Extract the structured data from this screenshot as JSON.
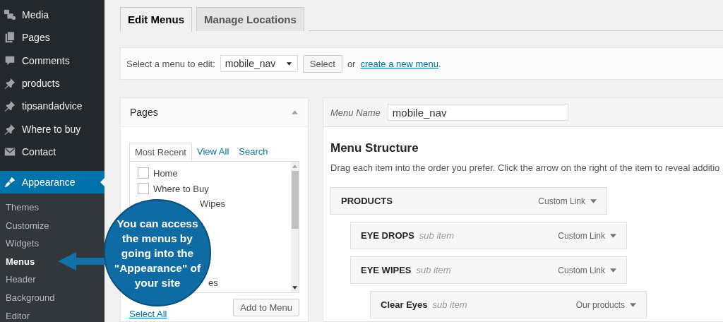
{
  "sidebar": {
    "items": [
      {
        "label": "Media",
        "kind": "media",
        "selected": false
      },
      {
        "label": "Pages",
        "kind": "pages",
        "selected": false
      },
      {
        "label": "Comments",
        "kind": "comments",
        "selected": false
      },
      {
        "label": "products",
        "kind": "pin",
        "selected": false
      },
      {
        "label": "tipsandadvice",
        "kind": "pin",
        "selected": false
      },
      {
        "label": "Where to buy",
        "kind": "pin",
        "selected": false
      },
      {
        "label": "Contact",
        "kind": "mail",
        "selected": false
      },
      {
        "label": "Appearance",
        "kind": "brush",
        "selected": true
      }
    ],
    "submenu": [
      {
        "label": "Themes",
        "selected": false
      },
      {
        "label": "Customize",
        "selected": false
      },
      {
        "label": "Widgets",
        "selected": false
      },
      {
        "label": "Menus",
        "selected": true
      },
      {
        "label": "Header",
        "selected": false
      },
      {
        "label": "Background",
        "selected": false
      },
      {
        "label": "Editor",
        "selected": false
      }
    ]
  },
  "tabs": [
    {
      "label": "Edit Menus",
      "selected": true
    },
    {
      "label": "Manage Locations",
      "selected": false
    }
  ],
  "menu_select": {
    "label": "Select a menu to edit:",
    "value": "mobile_nav",
    "button": "Select",
    "or_text": "or",
    "link": "create a new menu",
    "after": "."
  },
  "pages_panel": {
    "title": "Pages",
    "tabs": [
      {
        "label": "Most Recent",
        "selected": true
      },
      {
        "label": "View All",
        "selected": false
      },
      {
        "label": "Search",
        "selected": false
      }
    ],
    "items": [
      {
        "label": "Home",
        "kind": "full",
        "checked": false
      },
      {
        "label": "Where to Buy",
        "kind": "full",
        "checked": false
      },
      {
        "label": "Wipes",
        "kind": "partial"
      },
      {
        "label": "es",
        "kind": "partial"
      }
    ],
    "select_all": "Select All",
    "add_button": "Add to Menu"
  },
  "menu_panel": {
    "name_label": "Menu Name",
    "name_value": "mobile_nav",
    "heading": "Menu Structure",
    "description": "Drag each item into the order you prefer. Click the arrow on the right of the item to reveal additio",
    "items": [
      {
        "title": "PRODUCTS",
        "type": "Custom Link",
        "children": [
          {
            "title": "EYE DROPS",
            "subtitle": "sub item",
            "type": "Custom Link"
          },
          {
            "title": "EYE WIPES",
            "subtitle": "sub item",
            "type": "Custom Link",
            "children": [
              {
                "title": "Clear Eyes",
                "subtitle": "sub item",
                "type": "Our products"
              }
            ]
          }
        ]
      }
    ]
  },
  "callout": {
    "text": "You can access the menus by going into the \"Appearance\" of your site"
  }
}
